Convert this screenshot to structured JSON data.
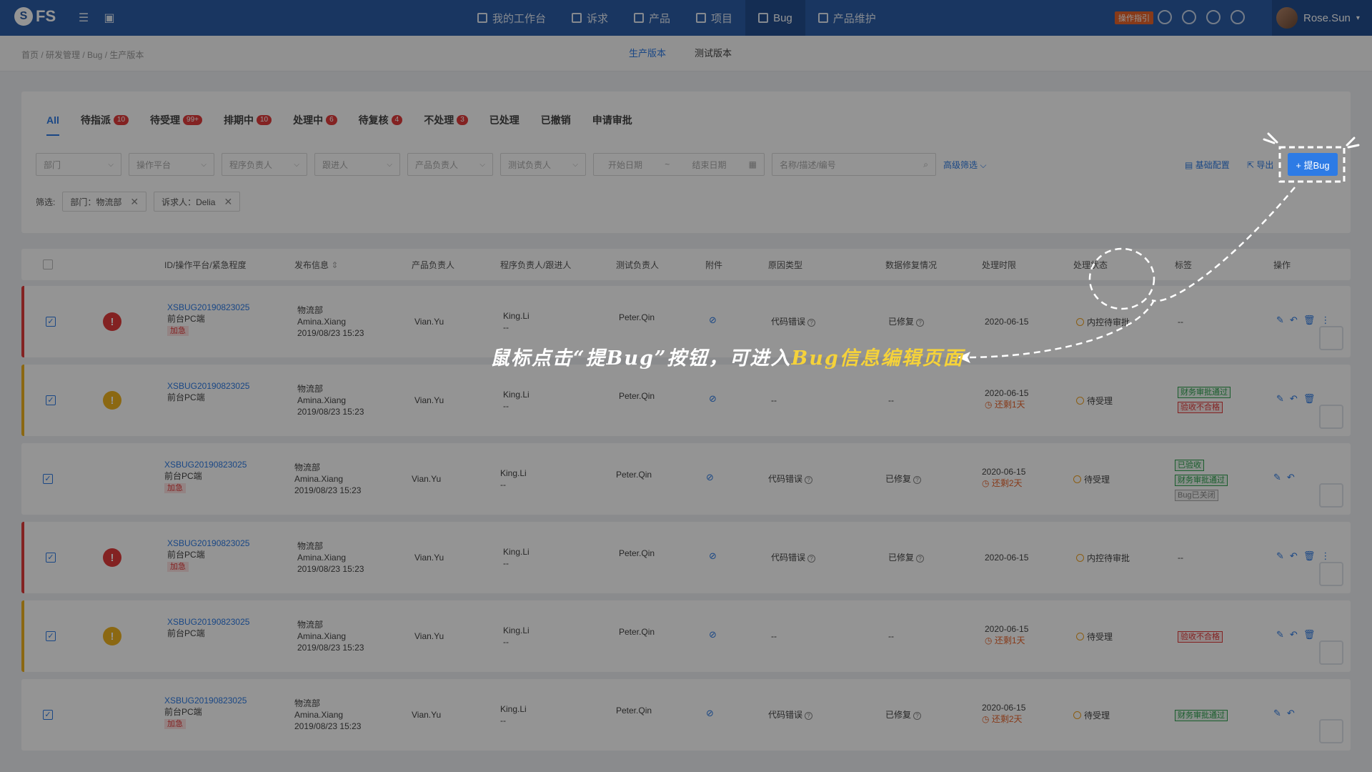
{
  "app": {
    "logo": "FS",
    "user": "Rose.Sun",
    "guide": "操作指引"
  },
  "nav": [
    "我的工作台",
    "诉求",
    "产品",
    "项目",
    "Bug",
    "产品维护"
  ],
  "breadcrumb": "首页 / 研发管理 / Bug / 生产版本",
  "version_tabs": [
    "生产版本",
    "测试版本"
  ],
  "status_tabs": [
    {
      "label": "All",
      "count": ""
    },
    {
      "label": "待指派",
      "count": "10"
    },
    {
      "label": "待受理",
      "count": "99+"
    },
    {
      "label": "排期中",
      "count": "10"
    },
    {
      "label": "处理中",
      "count": "6"
    },
    {
      "label": "待复核",
      "count": "4"
    },
    {
      "label": "不处理",
      "count": "3"
    },
    {
      "label": "已处理",
      "count": ""
    },
    {
      "label": "已撤销",
      "count": ""
    },
    {
      "label": "申请审批",
      "count": ""
    }
  ],
  "filters": {
    "dept": "部门",
    "platform": "操作平台",
    "dev_owner": "程序负责人",
    "follower": "跟进人",
    "product_owner": "产品负责人",
    "test_owner": "测试负责人",
    "start_date": "开始日期",
    "date_sep": "~",
    "end_date": "结束日期",
    "search": "名称/描述/编号",
    "advanced": "高级筛选",
    "config": "基础配置",
    "export": "导出",
    "add_bug": "+ 提Bug"
  },
  "chips": {
    "label": "筛选:",
    "items": [
      "部门：物流部",
      "诉求人：Delia"
    ]
  },
  "columns": [
    "ID/操作平台/紧急程度",
    "发布信息",
    "产品负责人",
    "程序负责人/跟进人",
    "测试负责人",
    "附件",
    "原因类型",
    "数据修复情况",
    "处理时限",
    "处理状态",
    "标签",
    "操作"
  ],
  "rows": [
    {
      "color": "red",
      "urgency": "!",
      "id": "XSBUG20190823025",
      "platform": "前台PC端",
      "urgent": "加急",
      "dept": "物流部",
      "publisher": "Amina.Xiang",
      "time": "2019/08/23 15:23",
      "pm": "Vian.Yu",
      "dev": "King.Li",
      "follow": "--",
      "tester": "Peter.Qin",
      "cause": "代码错误",
      "repair": "已修复",
      "deadline": "2020-06-15",
      "left": "",
      "state": "内控待审批",
      "labels": [],
      "labels_text": "--"
    },
    {
      "color": "yellow",
      "urgency": "!",
      "id": "XSBUG20190823025",
      "platform": "前台PC端",
      "urgent": "",
      "dept": "物流部",
      "publisher": "Amina.Xiang",
      "time": "2019/08/23 15:23",
      "pm": "Vian.Yu",
      "dev": "King.Li",
      "follow": "--",
      "tester": "Peter.Qin",
      "cause": "--",
      "repair": "--",
      "deadline": "2020-06-15",
      "left": "还剩1天",
      "state": "待受理",
      "labels": [
        {
          "t": "财务审批通过",
          "c": "green"
        },
        {
          "t": "验收不合格",
          "c": "red"
        }
      ],
      "labels_text": ""
    },
    {
      "color": "none",
      "urgency": "",
      "id": "XSBUG20190823025",
      "platform": "前台PC端",
      "urgent": "加急",
      "dept": "物流部",
      "publisher": "Amina.Xiang",
      "time": "2019/08/23 15:23",
      "pm": "Vian.Yu",
      "dev": "King.Li",
      "follow": "--",
      "tester": "Peter.Qin",
      "cause": "代码错误",
      "repair": "已修复",
      "deadline": "2020-06-15",
      "left": "还剩2天",
      "state": "待受理",
      "labels": [
        {
          "t": "已验收",
          "c": "green"
        },
        {
          "t": "财务审批通过",
          "c": "green"
        },
        {
          "t": "Bug已关闭",
          "c": "gray"
        }
      ],
      "labels_text": ""
    },
    {
      "color": "red",
      "urgency": "!",
      "id": "XSBUG20190823025",
      "platform": "前台PC端",
      "urgent": "加急",
      "dept": "物流部",
      "publisher": "Amina.Xiang",
      "time": "2019/08/23 15:23",
      "pm": "Vian.Yu",
      "dev": "King.Li",
      "follow": "--",
      "tester": "Peter.Qin",
      "cause": "代码错误",
      "repair": "已修复",
      "deadline": "2020-06-15",
      "left": "",
      "state": "内控待审批",
      "labels": [],
      "labels_text": "--"
    },
    {
      "color": "yellow",
      "urgency": "!",
      "id": "XSBUG20190823025",
      "platform": "前台PC端",
      "urgent": "",
      "dept": "物流部",
      "publisher": "Amina.Xiang",
      "time": "2019/08/23 15:23",
      "pm": "Vian.Yu",
      "dev": "King.Li",
      "follow": "--",
      "tester": "Peter.Qin",
      "cause": "--",
      "repair": "--",
      "deadline": "2020-06-15",
      "left": "还剩1天",
      "state": "待受理",
      "labels": [
        {
          "t": "验收不合格",
          "c": "red"
        }
      ],
      "labels_text": ""
    },
    {
      "color": "none",
      "urgency": "",
      "id": "XSBUG20190823025",
      "platform": "前台PC端",
      "urgent": "加急",
      "dept": "物流部",
      "publisher": "Amina.Xiang",
      "time": "2019/08/23 15:23",
      "pm": "Vian.Yu",
      "dev": "King.Li",
      "follow": "--",
      "tester": "Peter.Qin",
      "cause": "代码错误",
      "repair": "已修复",
      "deadline": "2020-06-15",
      "left": "还剩2天",
      "state": "待受理",
      "labels": [
        {
          "t": "财务审批通过",
          "c": "green"
        }
      ],
      "labels_text": ""
    }
  ],
  "annotation": {
    "text_a": "鼠标点击“提Bug”按钮，可进入",
    "text_b": "Bug信息编辑页面"
  },
  "colors": {
    "primary": "#2d7be5",
    "nav": "#2b5ea8",
    "danger": "#e23b3b",
    "warning": "#f0b31f"
  }
}
